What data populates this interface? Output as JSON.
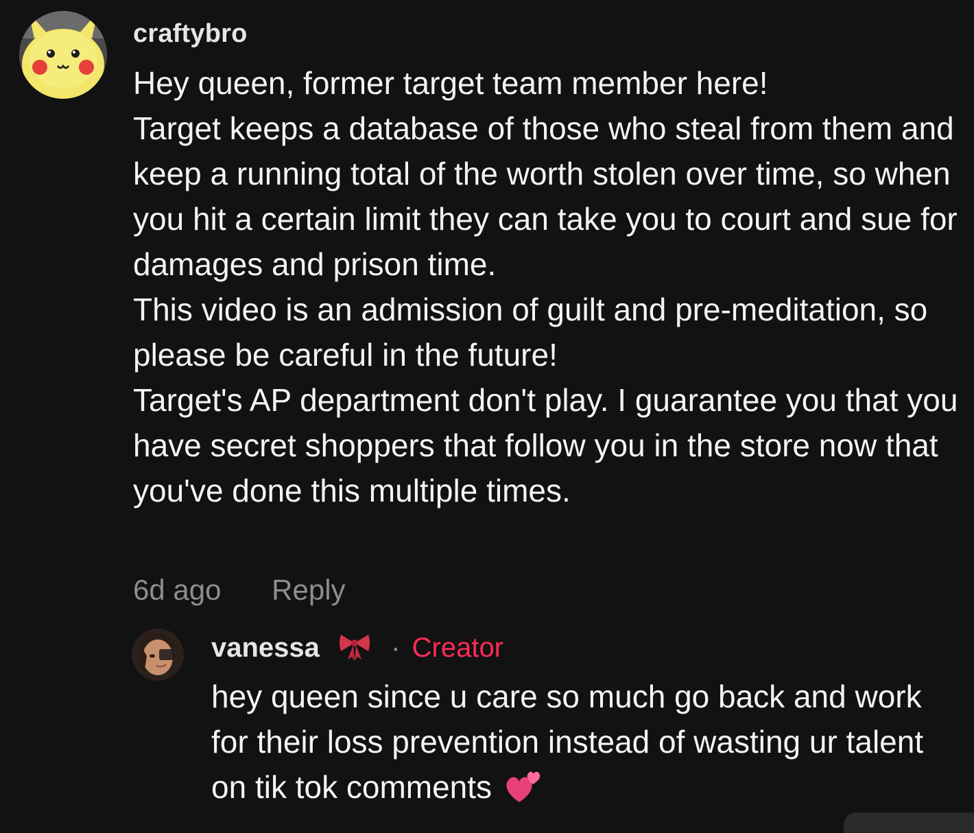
{
  "comment": {
    "username": "craftybro",
    "avatar_icon": "pikachu-avatar-icon",
    "body": "Hey queen, former target team member here!\nTarget keeps a database of those who steal from them and keep a running total of the worth stolen over time, so when you hit a certain limit they can take you to court and sue for damages and prison time.\nThis video is an admission of guilt and pre-meditation, so please be careful in the future!\nTarget's AP department don't play. I guarantee you that you have secret shoppers that follow you in the store now that you've done this multiple times.",
    "timestamp": "6d ago",
    "reply_label": "Reply"
  },
  "reply": {
    "username": "vanessa",
    "badge_icon": "ribbon-bow-icon",
    "separator": "·",
    "role": "Creator",
    "body": "hey queen since u care so much go back and work for their loss prevention instead of wasting ur talent on tik tok comments",
    "emoji_icon": "two-hearts-icon"
  },
  "colors": {
    "background": "#121212",
    "text": "#f4f4f4",
    "muted": "#8e8e8e",
    "creator_accent": "#fe2c55"
  }
}
